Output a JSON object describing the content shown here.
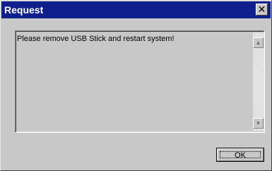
{
  "window": {
    "title": "Request",
    "close_glyph": "✕"
  },
  "message": {
    "text": "Please remove USB Stick and restart system!"
  },
  "scrollbar": {
    "up_glyph": "▲",
    "down_glyph": "▼"
  },
  "buttons": {
    "ok_label": "OK"
  },
  "colors": {
    "titlebar": "#0f1f8c",
    "window_bg": "#c8c8c8",
    "title_text": "#ffffff"
  }
}
